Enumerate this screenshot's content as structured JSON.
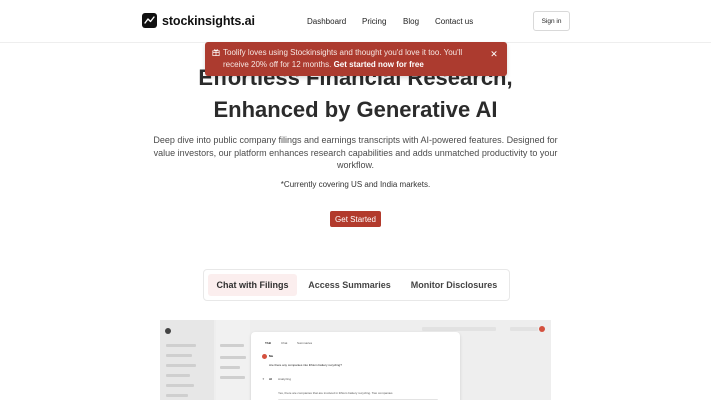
{
  "brand": {
    "name": "stockinsights.ai"
  },
  "nav": {
    "items": [
      "Dashboard",
      "Pricing",
      "Blog",
      "Contact us"
    ],
    "signin": "Sign in"
  },
  "banner": {
    "text": "Toolify loves using Stockinsights and thought you'd love it too. You'll receive 20% off for 12 months.",
    "cta": "Get started now for free",
    "icon": "gift-icon",
    "close_icon": "close-icon"
  },
  "hero": {
    "line1": "Effortless Financial Research,",
    "line2": "Enhanced by Generative AI",
    "description": "Deep dive into public company filings and earnings transcripts with AI-powered features. Designed for value investors, our platform enhances research capabilities and adds unmatched productivity to your workflow.",
    "coverage": "*Currently covering US and India markets.",
    "cta": "Get Started"
  },
  "tabs": [
    {
      "label": "Chat with Filings",
      "active": true
    },
    {
      "label": "Access Summaries",
      "active": false
    },
    {
      "label": "Monitor Disclosures",
      "active": false
    }
  ],
  "preview": {
    "tab_labels": [
      "TAB",
      "Chat",
      "Summaries"
    ],
    "user_label": "Me",
    "question": "Are there any companies into lithium battery recycling?",
    "ai_label": "AI",
    "ai_status": "Analyzing",
    "answer": "Yes, there are companies that are involved in lithium battery recycling. Two companies"
  },
  "colors": {
    "accent": "#b23a2c",
    "banner": "#ac3b2f",
    "tab_active_bg": "#fbeeee"
  }
}
